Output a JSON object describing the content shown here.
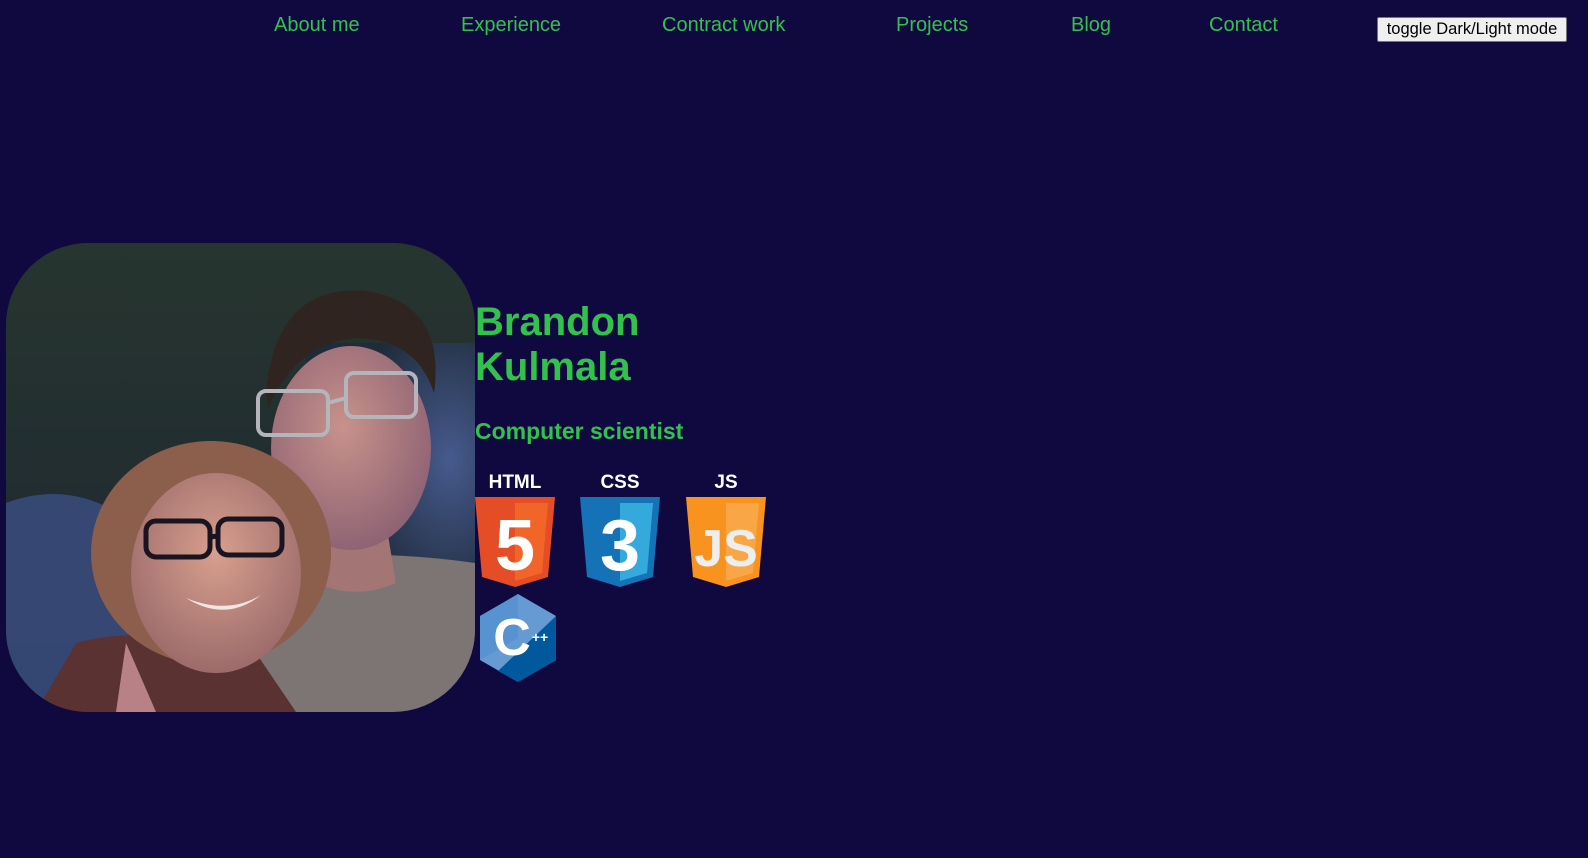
{
  "nav": {
    "items": [
      {
        "label": "About me"
      },
      {
        "label": "Experience"
      },
      {
        "label": "Contract work"
      },
      {
        "label": "Projects"
      },
      {
        "label": "Blog"
      },
      {
        "label": "Contact"
      }
    ],
    "toggle_label": "toggle Dark/Light mode"
  },
  "hero": {
    "name_first": "Brandon",
    "name_last": "Kulmala",
    "role": "Computer scientist"
  },
  "tech_icons": {
    "html": {
      "label": "HTML",
      "glyph": "5",
      "icon": "html5-icon",
      "color": "#e44d26"
    },
    "css": {
      "label": "CSS",
      "glyph": "3",
      "icon": "css3-icon",
      "color": "#1572b6"
    },
    "js": {
      "label": "JS",
      "glyph": "JS",
      "icon": "javascript-icon",
      "color": "#f7931e"
    },
    "cpp": {
      "glyph": "C",
      "sub": "++",
      "icon": "cpp-icon",
      "color": "#00599c"
    }
  },
  "colors": {
    "background": "#10093f",
    "accent": "#33c14e"
  }
}
